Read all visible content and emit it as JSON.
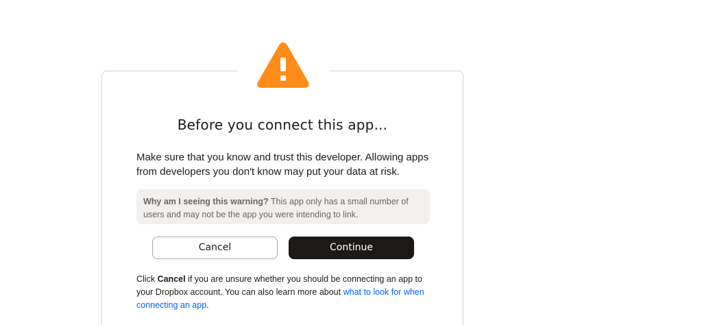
{
  "dialog": {
    "title": "Before you connect this app...",
    "intro": "Make sure that you know and trust this developer. Allowing apps from developers you don't know may put your data at risk.",
    "notice": {
      "heading": "Why am I seeing this warning?",
      "body": "This app only has a small number of users and may not be the app you were intending to link."
    },
    "buttons": {
      "cancel": "Cancel",
      "continue": "Continue"
    },
    "footer": {
      "prefix": "Click",
      "cancel_word": "Cancel",
      "middle": "if you are unsure whether you should be connecting an app to your Dropbox account. You can also learn more about",
      "link_text": "what to look for when connecting an app",
      "suffix": "."
    },
    "icon": "warning-triangle-icon"
  },
  "colors": {
    "warning": "#ff8c19",
    "primary_button": "#1e1919",
    "link": "#0061fe",
    "notice_bg": "#f2f0ee"
  }
}
